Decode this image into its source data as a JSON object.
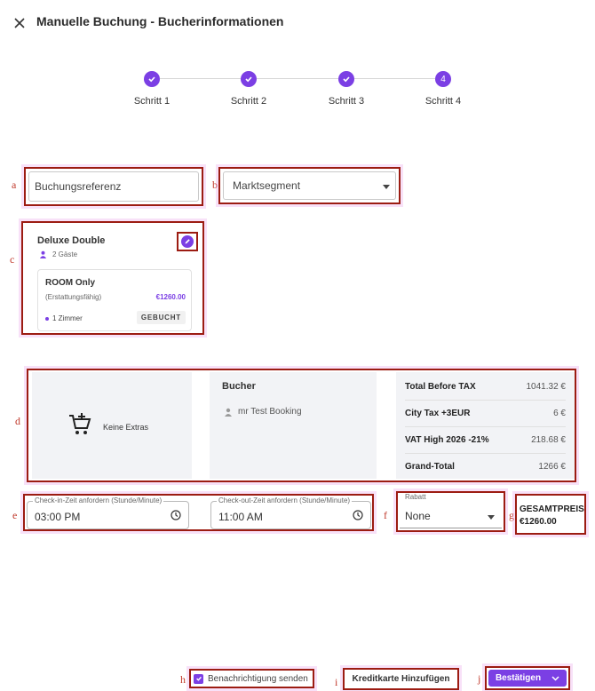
{
  "header": {
    "title": "Manuelle Buchung - Bucherinformationen",
    "close_icon": "close-icon"
  },
  "stepper": {
    "steps": [
      {
        "label": "Schritt 1",
        "state": "done"
      },
      {
        "label": "Schritt 2",
        "state": "done"
      },
      {
        "label": "Schritt 3",
        "state": "done"
      },
      {
        "label": "Schritt 4",
        "state": "active",
        "number": "4"
      }
    ],
    "accent": "#7b3fe4"
  },
  "annotations": [
    "a",
    "b",
    "c",
    "d",
    "e",
    "f",
    "g",
    "h",
    "i",
    "j"
  ],
  "booking_reference": {
    "placeholder": "Buchungsreferenz"
  },
  "market_segment": {
    "placeholder": "Marktsegment"
  },
  "room": {
    "name": "Deluxe Double",
    "guests": "2 Gäste",
    "rate_name": "ROOM Only",
    "refund": "(Erstattungsfähig)",
    "price": "€1260.00",
    "rooms": "1 Zimmer",
    "status": "GEBUCHT"
  },
  "extras": {
    "label": "Keine Extras"
  },
  "booker": {
    "heading": "Bucher",
    "name": "mr Test Booking"
  },
  "totals": [
    {
      "label": "Total Before TAX",
      "value": "1041.32 €"
    },
    {
      "label": "City Tax +3EUR",
      "value": "6 €"
    },
    {
      "label": "VAT High 2026 -21%",
      "value": "218.68 €"
    },
    {
      "label": "Grand-Total",
      "value": "1266 €"
    }
  ],
  "checkin": {
    "legend": "Check-in-Zeit anfordern (Stunde/Minute)",
    "value": "03:00 PM"
  },
  "checkout": {
    "legend": "Check-out-Zeit anfordern (Stunde/Minute)",
    "value": "11:00 AM"
  },
  "discount": {
    "legend": "Rabatt",
    "value": "None"
  },
  "total_price": {
    "label": "GESAMTPREIS",
    "value": "€1260.00"
  },
  "footer": {
    "notify_label": "Benachrichtigung senden",
    "notify_checked": true,
    "add_card_label": "Kreditkarte Hinzufügen",
    "confirm_label": "Bestätigen"
  }
}
